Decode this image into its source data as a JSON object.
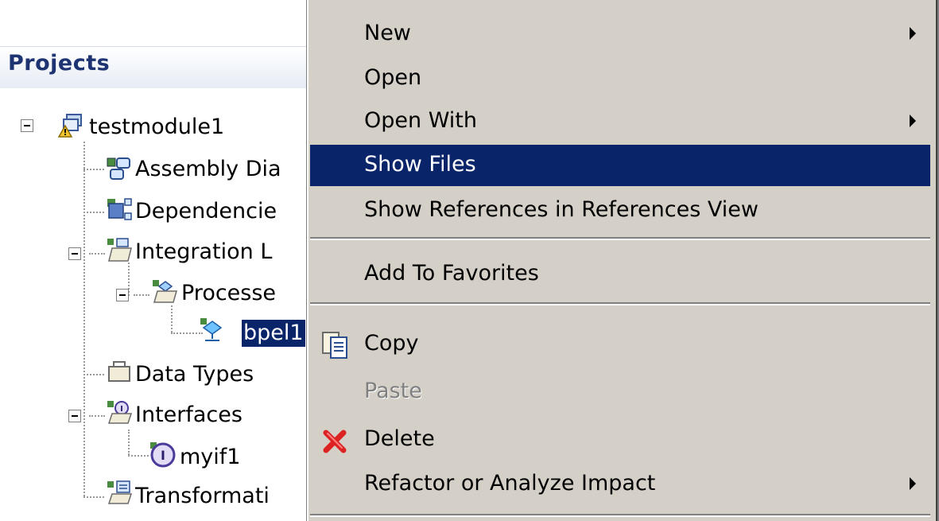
{
  "projects_panel": {
    "title": "Projects",
    "tree": [
      {
        "label": "testmodule1",
        "icon": "module-warning-icon",
        "expanded": true
      },
      {
        "label": "Assembly Dia",
        "icon": "assembly-diagram-icon"
      },
      {
        "label": "Dependencie",
        "icon": "dependencies-icon"
      },
      {
        "label": "Integration L",
        "icon": "integration-logic-folder-icon",
        "expanded": true
      },
      {
        "label": "Processe",
        "icon": "processes-folder-icon",
        "expanded": true
      },
      {
        "label": "bpel1",
        "icon": "bpel-process-icon",
        "selected": true
      },
      {
        "label": "Data Types",
        "icon": "data-types-icon"
      },
      {
        "label": "Interfaces",
        "icon": "interfaces-folder-icon",
        "expanded": true
      },
      {
        "label": "myif1",
        "icon": "interface-icon"
      },
      {
        "label": "Transformati",
        "icon": "transformations-icon"
      }
    ]
  },
  "context_menu": {
    "items": [
      {
        "label": "New",
        "submenu": true
      },
      {
        "label": "Open"
      },
      {
        "label": "Open With",
        "submenu": true
      },
      {
        "label": "Show Files",
        "highlighted": true
      },
      {
        "label": "Show References in References View"
      },
      {
        "label": "Add To Favorites"
      },
      {
        "label": "Copy",
        "icon": "copy-icon"
      },
      {
        "label": "Paste",
        "disabled": true
      },
      {
        "label": "Delete",
        "icon": "delete-icon"
      },
      {
        "label": "Refactor or Analyze Impact",
        "submenu": true
      }
    ]
  },
  "colors": {
    "selection": "#0a246a",
    "menu_background": "#d4d0c8",
    "panel_title": "#1e3472"
  }
}
